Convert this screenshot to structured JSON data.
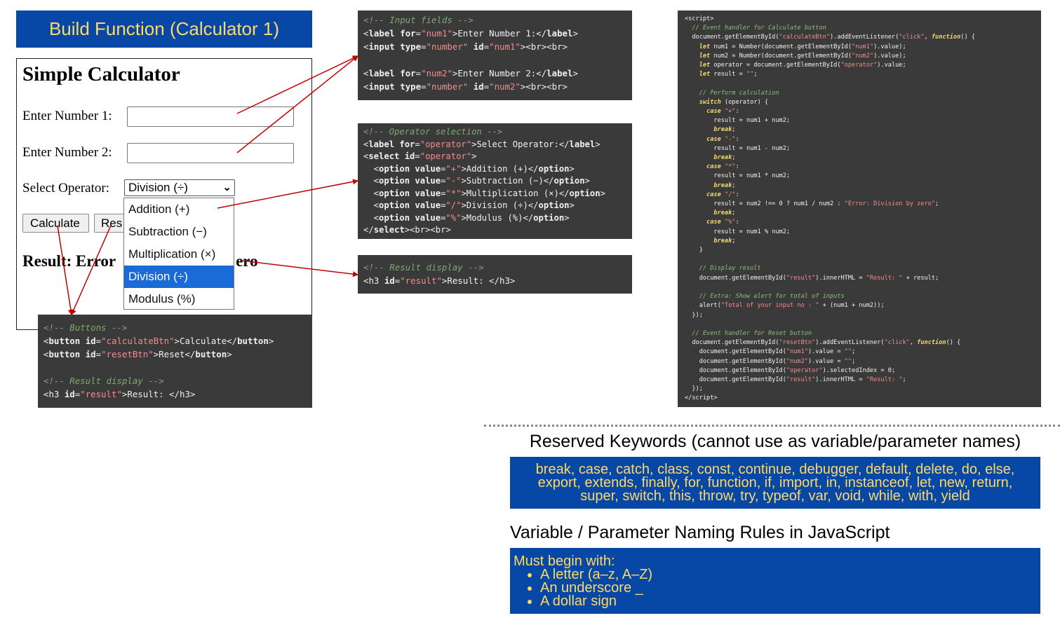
{
  "title": "Build Function (Calculator 1)",
  "calculator": {
    "heading": "Simple Calculator",
    "num1_label": "Enter Number 1:",
    "num2_label": "Enter Number 2:",
    "operator_label": "Select Operator:",
    "operator_selected": "Division (÷)",
    "calculate_label": "Calculate",
    "reset_label_visible": "Res",
    "result_visible_left": "Result: Error",
    "result_visible_right": "ero",
    "operator_options": [
      "Addition (+)",
      "Subtraction (−)",
      "Multiplication (×)",
      "Division (÷)",
      "Modulus (%)"
    ]
  },
  "code_input_fields": {
    "comment": "<!-- Input fields -->",
    "line1_label_text": "Enter Number 1:",
    "line3_label_text": "Enter Number 2:"
  },
  "code_operator": {
    "comment": "<!-- Operator selection -->"
  },
  "code_result": {
    "comment": "<!-- Result display -->"
  },
  "code_buttons": {
    "comment1": "<!-- Buttons -->",
    "comment2": "<!-- Result display -->"
  },
  "reserved": {
    "title": "Reserved Keywords (cannot use as variable/parameter names)",
    "keywords": "break, case, catch, class, const, continue, debugger, default, delete, do, else, export, extends, finally, for, function, if, import, in, instanceof, let, new, return, super, switch, this, throw, try, typeof, var, void, while, with, yield"
  },
  "naming_rules": {
    "title": "Variable / Parameter Naming Rules in JavaScript",
    "intro": "Must begin with:",
    "items": [
      "A letter (a–z, A–Z)",
      "An underscore _",
      "A dollar sign"
    ]
  },
  "colors": {
    "banner_bg": "#0747a6",
    "banner_text": "#ffd966",
    "code_bg": "#3a3a3a",
    "arrow": "#c00000",
    "dropdown_selected": "#1a6bd8"
  }
}
